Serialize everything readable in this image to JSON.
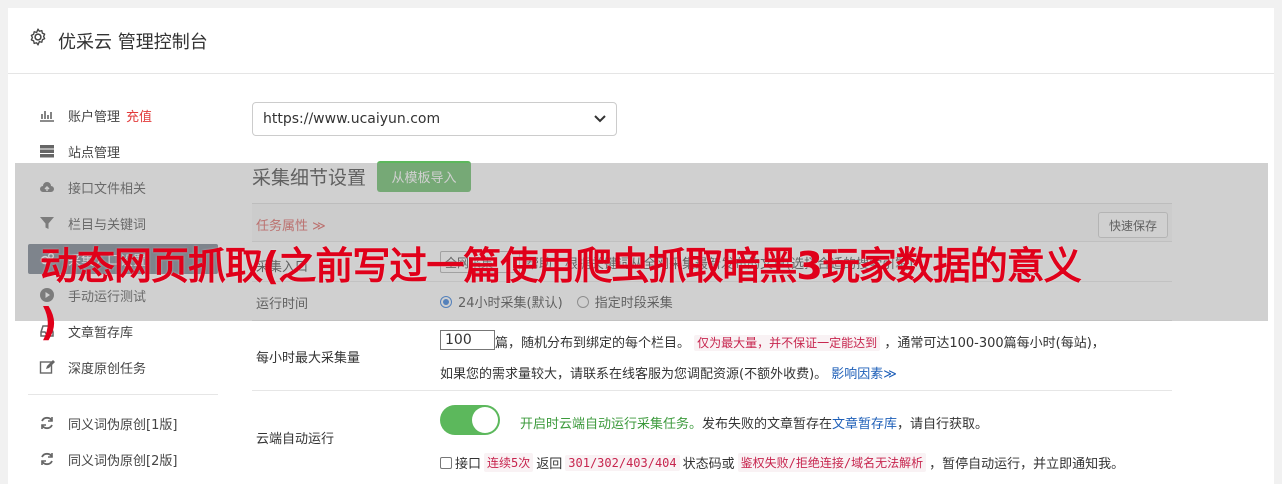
{
  "header": {
    "title": "优采云 管理控制台"
  },
  "sidebar": {
    "items": [
      {
        "label": "账户管理",
        "extra": "充值",
        "icon": "bar-chart-icon"
      },
      {
        "label": "站点管理",
        "icon": "server-icon"
      },
      {
        "label": "接口文件相关",
        "icon": "cloud-upload-icon"
      },
      {
        "label": "栏目与关键词",
        "icon": "filter-icon"
      },
      {
        "label": "采集入口设置",
        "icon": "gears-icon",
        "active": true
      },
      {
        "label": "手动运行测试",
        "icon": "play-circle-icon"
      },
      {
        "label": "文章暂存库",
        "icon": "inbox-icon"
      },
      {
        "label": "深度原创任务",
        "icon": "edit-icon"
      },
      {
        "label": "同义词伪原创[1版]",
        "icon": "refresh-icon"
      },
      {
        "label": "同义词伪原创[2版]",
        "icon": "refresh-icon"
      }
    ]
  },
  "site_select": {
    "value": "https://www.ucaiyun.com"
  },
  "section": {
    "title": "采集细节设置",
    "template_button": "从模板导入"
  },
  "task": {
    "header_label": "任务属性 ≫",
    "save_button": "快速保存",
    "mode_row": {
      "label": "采集入口",
      "select_value": "全网采集",
      "desc": "帮助：根据关键词从全网采集最新发布的文章(选择合适的搜索引擎)"
    },
    "runtime_row": {
      "label": "运行时间",
      "option_a": "24小时采集(默认)",
      "option_b": "指定时段采集"
    },
    "rate_row": {
      "label": "每小时最大采集量",
      "value": "100",
      "text1": "篇，随机分布到绑定的每个栏目。",
      "code1": "仅为最大量，并不保证一定能达到",
      "text2": "，通常可达100-300篇每小时(每站)，",
      "text3": "如果您的需求量较大，请联系在线客服为您调配资源(不额外收费)。",
      "link": "影响因素≫"
    },
    "cloud_row": {
      "label": "云端自动运行",
      "on_text": "开启时云端自动运行采集任务。",
      "text1": "发布失败的文章暂存在",
      "link": "文章暂存库",
      "text2": "，请自行获取。",
      "chk_text1": "接口",
      "code1": "连续5次",
      "chk_text2": "返回",
      "code2": "301/302/403/404",
      "chk_text3": "状态码或",
      "code3": "鉴权失败/拒绝连接/域名无法解析",
      "chk_text4": "，暂停自动运行，并立即通知我。"
    }
  },
  "banner": {
    "line1": "动态网页抓取(之前写过一篇使用爬虫抓取暗黑3玩家数据的意义",
    "line2": ")"
  },
  "colors": {
    "accent_green": "#5cb85c",
    "banner_red": "#e0001a",
    "active_bg": "#6b7584"
  }
}
